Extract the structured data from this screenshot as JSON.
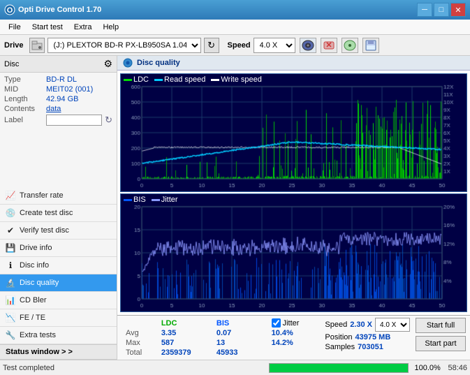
{
  "titlebar": {
    "title": "Opti Drive Control 1.70",
    "min_btn": "─",
    "max_btn": "□",
    "close_btn": "✕"
  },
  "menubar": {
    "items": [
      "File",
      "Start test",
      "Extra",
      "Help"
    ]
  },
  "drivebar": {
    "drive_label": "Drive",
    "drive_value": "(J:) PLEXTOR BD-R PX-LB950SA 1.04",
    "speed_label": "Speed",
    "speed_value": "4.0 X"
  },
  "disc": {
    "header": "Disc",
    "type_label": "Type",
    "type_value": "BD-R DL",
    "mid_label": "MID",
    "mid_value": "MEIT02 (001)",
    "length_label": "Length",
    "length_value": "42.94 GB",
    "contents_label": "Contents",
    "contents_value": "data",
    "label_label": "Label",
    "label_value": ""
  },
  "sidebar_items": [
    {
      "id": "transfer-rate",
      "label": "Transfer rate",
      "active": false
    },
    {
      "id": "create-test-disc",
      "label": "Create test disc",
      "active": false
    },
    {
      "id": "verify-test-disc",
      "label": "Verify test disc",
      "active": false
    },
    {
      "id": "drive-info",
      "label": "Drive info",
      "active": false
    },
    {
      "id": "disc-info",
      "label": "Disc info",
      "active": false
    },
    {
      "id": "disc-quality",
      "label": "Disc quality",
      "active": true
    },
    {
      "id": "cd-bler",
      "label": "CD Bler",
      "active": false
    },
    {
      "id": "fe-te",
      "label": "FE / TE",
      "active": false
    },
    {
      "id": "extra-tests",
      "label": "Extra tests",
      "active": false
    }
  ],
  "status_window": {
    "label": "Status window > >"
  },
  "content_header": {
    "title": "Disc quality"
  },
  "chart1": {
    "legend": [
      {
        "name": "LDC",
        "color": "#00aa00"
      },
      {
        "name": "Read speed",
        "color": "#00ccff"
      },
      {
        "name": "Write speed",
        "color": "#ffffff"
      }
    ],
    "y_max": 600,
    "y_right_max": 12,
    "x_max": 50
  },
  "chart2": {
    "legend": [
      {
        "name": "BIS",
        "color": "#0044ff"
      },
      {
        "name": "Jitter",
        "color": "#8888ff"
      }
    ],
    "y_max": 20,
    "y_right_max_pct": 20,
    "x_max": 50
  },
  "stats": {
    "columns": [
      "LDC",
      "BIS",
      "",
      "Jitter"
    ],
    "avg_label": "Avg",
    "avg_ldc": "3.35",
    "avg_bis": "0.07",
    "avg_jitter": "10.4%",
    "max_label": "Max",
    "max_ldc": "587",
    "max_bis": "13",
    "max_jitter": "14.2%",
    "total_label": "Total",
    "total_ldc": "2359379",
    "total_bis": "45933",
    "jitter_checked": true,
    "jitter_label": "Jitter"
  },
  "speed_info": {
    "speed_label": "Speed",
    "speed_current": "2.30 X",
    "speed_select": "4.0 X",
    "position_label": "Position",
    "position_value": "43975 MB",
    "samples_label": "Samples",
    "samples_value": "703051"
  },
  "buttons": {
    "start_full": "Start full",
    "start_part": "Start part"
  },
  "statusbar": {
    "status_text": "Test completed",
    "progress_pct": 100,
    "progress_label": "100.0%",
    "time": "58:46"
  }
}
